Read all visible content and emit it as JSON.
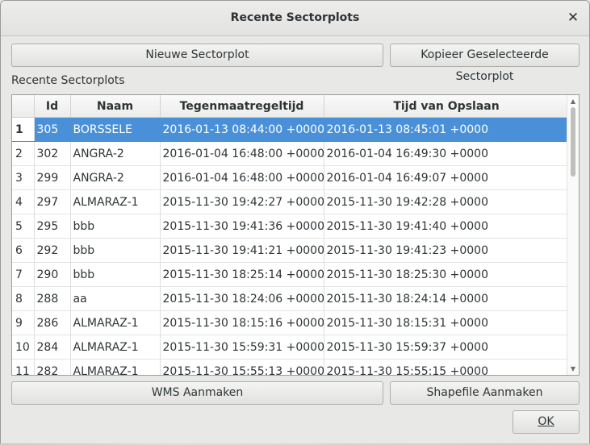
{
  "window": {
    "title": "Recente Sectorplots"
  },
  "toolbar": {
    "new_label": "Nieuwe Sectorplot",
    "copy_label": "Kopieer Geselecteerde Sectorplot"
  },
  "section_label": "Recente Sectorplots",
  "table": {
    "columns": [
      "",
      "Id",
      "Naam",
      "Tegenmaatregeltijd",
      "Tijd van Opslaan"
    ],
    "selected_row": 1,
    "rows": [
      {
        "num": "1",
        "id": "305",
        "name": "BORSSELE",
        "measure_time": "2016-01-13 08:44:00 +0000",
        "save_time": "2016-01-13 08:45:01 +0000"
      },
      {
        "num": "2",
        "id": "302",
        "name": "ANGRA-2",
        "measure_time": "2016-01-04 16:48:00 +0000",
        "save_time": "2016-01-04 16:49:30 +0000"
      },
      {
        "num": "3",
        "id": "299",
        "name": "ANGRA-2",
        "measure_time": "2016-01-04 16:48:00 +0000",
        "save_time": "2016-01-04 16:49:07 +0000"
      },
      {
        "num": "4",
        "id": "297",
        "name": "ALMARAZ-1",
        "measure_time": "2015-11-30 19:42:27 +0000",
        "save_time": "2015-11-30 19:42:28 +0000"
      },
      {
        "num": "5",
        "id": "295",
        "name": "bbb",
        "measure_time": "2015-11-30 19:41:36 +0000",
        "save_time": "2015-11-30 19:41:40 +0000"
      },
      {
        "num": "6",
        "id": "292",
        "name": "bbb",
        "measure_time": "2015-11-30 19:41:21 +0000",
        "save_time": "2015-11-30 19:41:23 +0000"
      },
      {
        "num": "7",
        "id": "290",
        "name": "bbb",
        "measure_time": "2015-11-30 18:25:14 +0000",
        "save_time": "2015-11-30 18:25:30 +0000"
      },
      {
        "num": "8",
        "id": "288",
        "name": "aa",
        "measure_time": "2015-11-30 18:24:06 +0000",
        "save_time": "2015-11-30 18:24:14 +0000"
      },
      {
        "num": "9",
        "id": "286",
        "name": "ALMARAZ-1",
        "measure_time": "2015-11-30 18:15:16 +0000",
        "save_time": "2015-11-30 18:15:31 +0000"
      },
      {
        "num": "10",
        "id": "284",
        "name": "ALMARAZ-1",
        "measure_time": "2015-11-30 15:59:31 +0000",
        "save_time": "2015-11-30 15:59:37 +0000"
      },
      {
        "num": "11",
        "id": "282",
        "name": "ALMARAZ-1",
        "measure_time": "2015-11-30 15:55:13 +0000",
        "save_time": "2015-11-30 15:55:15 +0000"
      }
    ]
  },
  "actions": {
    "wms_label": "WMS Aanmaken",
    "shapefile_label": "Shapefile Aanmaken",
    "ok_label": "OK"
  },
  "colors": {
    "selection": "#4a90d9",
    "background": "#e8e8e7"
  }
}
